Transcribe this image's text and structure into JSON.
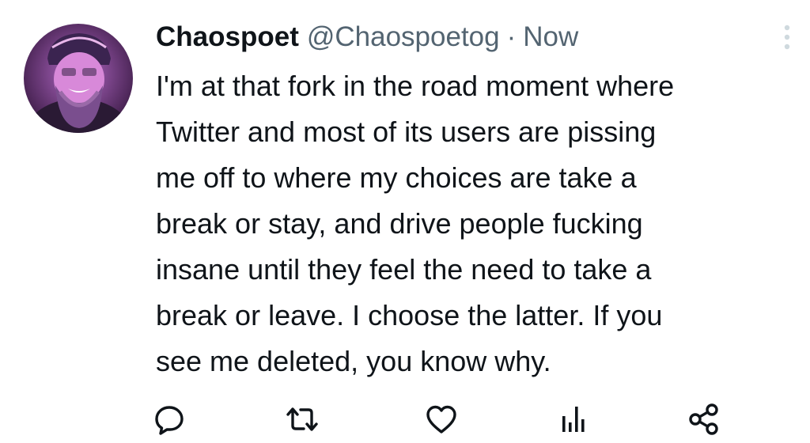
{
  "tweet": {
    "display_name": "Chaospoet",
    "handle": "@Chaospoetog",
    "separator": "·",
    "time": "Now",
    "body_lines": [
      "I'm at that fork in the road moment where",
      "Twitter and most of its users are pissing",
      "me off to where my choices are take a",
      "break or stay, and drive people fucking",
      "insane until they feel the need to take a",
      "break or leave. I choose the latter. If you",
      "see me deleted, you know why."
    ]
  },
  "icons": {
    "more": "vertical-ellipsis-icon",
    "reply": "speech-bubble-icon",
    "retweet": "retweet-arrows-icon",
    "like": "heart-outline-icon",
    "views": "bar-chart-icon",
    "share": "share-nodes-icon",
    "avatar": "user-avatar-photo"
  },
  "colors": {
    "text": "#0f1419",
    "secondary": "#536471",
    "background": "#ffffff"
  }
}
